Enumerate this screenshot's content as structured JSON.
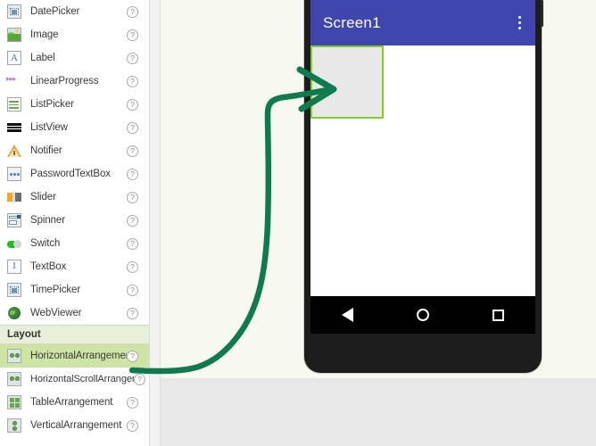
{
  "app": {
    "palette_items": [
      {
        "label": "DatePicker",
        "icon": "datepicker-icon",
        "help": "?"
      },
      {
        "label": "Image",
        "icon": "image-icon",
        "help": "?"
      },
      {
        "label": "Label",
        "icon": "label-icon",
        "help": "?"
      },
      {
        "label": "LinearProgress",
        "icon": "linear-progress-icon",
        "help": "?"
      },
      {
        "label": "ListPicker",
        "icon": "listpicker-icon",
        "help": "?"
      },
      {
        "label": "ListView",
        "icon": "listview-icon",
        "help": "?"
      },
      {
        "label": "Notifier",
        "icon": "notifier-icon",
        "help": "?"
      },
      {
        "label": "PasswordTextBox",
        "icon": "password-textbox-icon",
        "help": "?"
      },
      {
        "label": "Slider",
        "icon": "slider-icon",
        "help": "?"
      },
      {
        "label": "Spinner",
        "icon": "spinner-icon",
        "help": "?"
      },
      {
        "label": "Switch",
        "icon": "switch-icon",
        "help": "?"
      },
      {
        "label": "TextBox",
        "icon": "textbox-icon",
        "help": "?"
      },
      {
        "label": "TimePicker",
        "icon": "timepicker-icon",
        "help": "?"
      },
      {
        "label": "WebViewer",
        "icon": "webviewer-icon",
        "help": "?"
      }
    ],
    "section_layout": {
      "title": "Layout"
    },
    "layout_items": [
      {
        "label": "HorizontalArrangement",
        "icon": "horizontal-arrangement-icon",
        "help": "?",
        "selected": true
      },
      {
        "label": "HorizontalScrollArrangement",
        "icon": "horizontal-scroll-arrangement-icon",
        "help": "?",
        "selected": false
      },
      {
        "label": "TableArrangement",
        "icon": "table-arrangement-icon",
        "help": "?",
        "selected": false
      },
      {
        "label": "VerticalArrangement",
        "icon": "vertical-arrangement-icon",
        "help": "?",
        "selected": false
      }
    ]
  },
  "phone": {
    "title": "Screen1",
    "overflow_menu": "overflow-menu-icon",
    "dropped_component": "HorizontalArrangement1",
    "navbar": {
      "back": "back-icon",
      "home": "home-icon",
      "recents": "recents-icon"
    }
  },
  "annotation": {
    "type": "arrow",
    "color": "#0e7a4e",
    "from": "HorizontalArrangement palette item",
    "to": "dropped arrangement on Screen1"
  },
  "colors": {
    "titlebar": "#3f46ad",
    "selection_green": "#cde4a4",
    "component_border_green": "#7ed321",
    "arrow_green": "#0e7a4e",
    "viewer_bg": "#f7f8f0",
    "phone_body": "#1d1d1d"
  }
}
